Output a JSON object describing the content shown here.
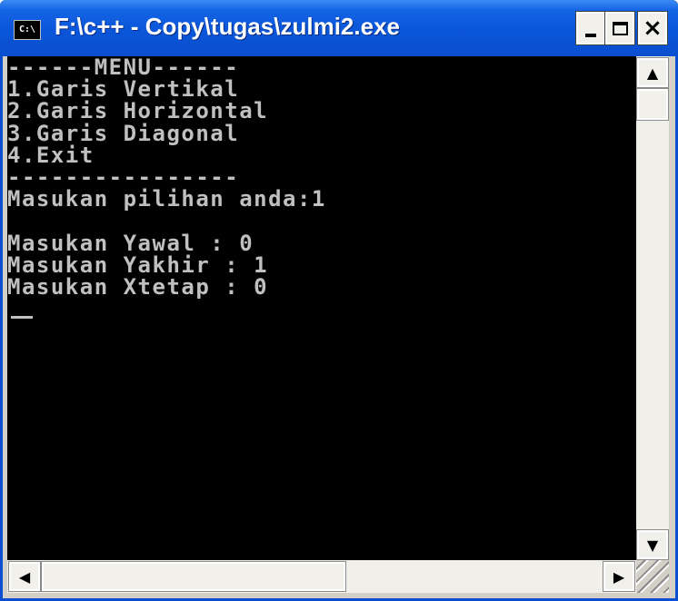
{
  "window": {
    "title": "F:\\c++ - Copy\\tugas\\zulmi2.exe",
    "icon_label": "C:\\",
    "buttons": {
      "minimize": "minimize",
      "maximize": "maximize",
      "close": "×"
    }
  },
  "console": {
    "lines": [
      "------MENU------",
      "1.Garis Vertikal",
      "2.Garis Horizontal",
      "3.Garis Diagonal",
      "4.Exit",
      "----------------",
      "Masukan pilihan anda:1",
      "",
      "Masukan Yawal : 0",
      "Masukan Yakhir : 1",
      "Masukan Xtetap : 0"
    ],
    "text_color": "#c0c0c0",
    "background": "#000000"
  },
  "scrollbars": {
    "up_arrow": "▲",
    "down_arrow": "▼",
    "left_arrow": "◀",
    "right_arrow": "▶"
  }
}
